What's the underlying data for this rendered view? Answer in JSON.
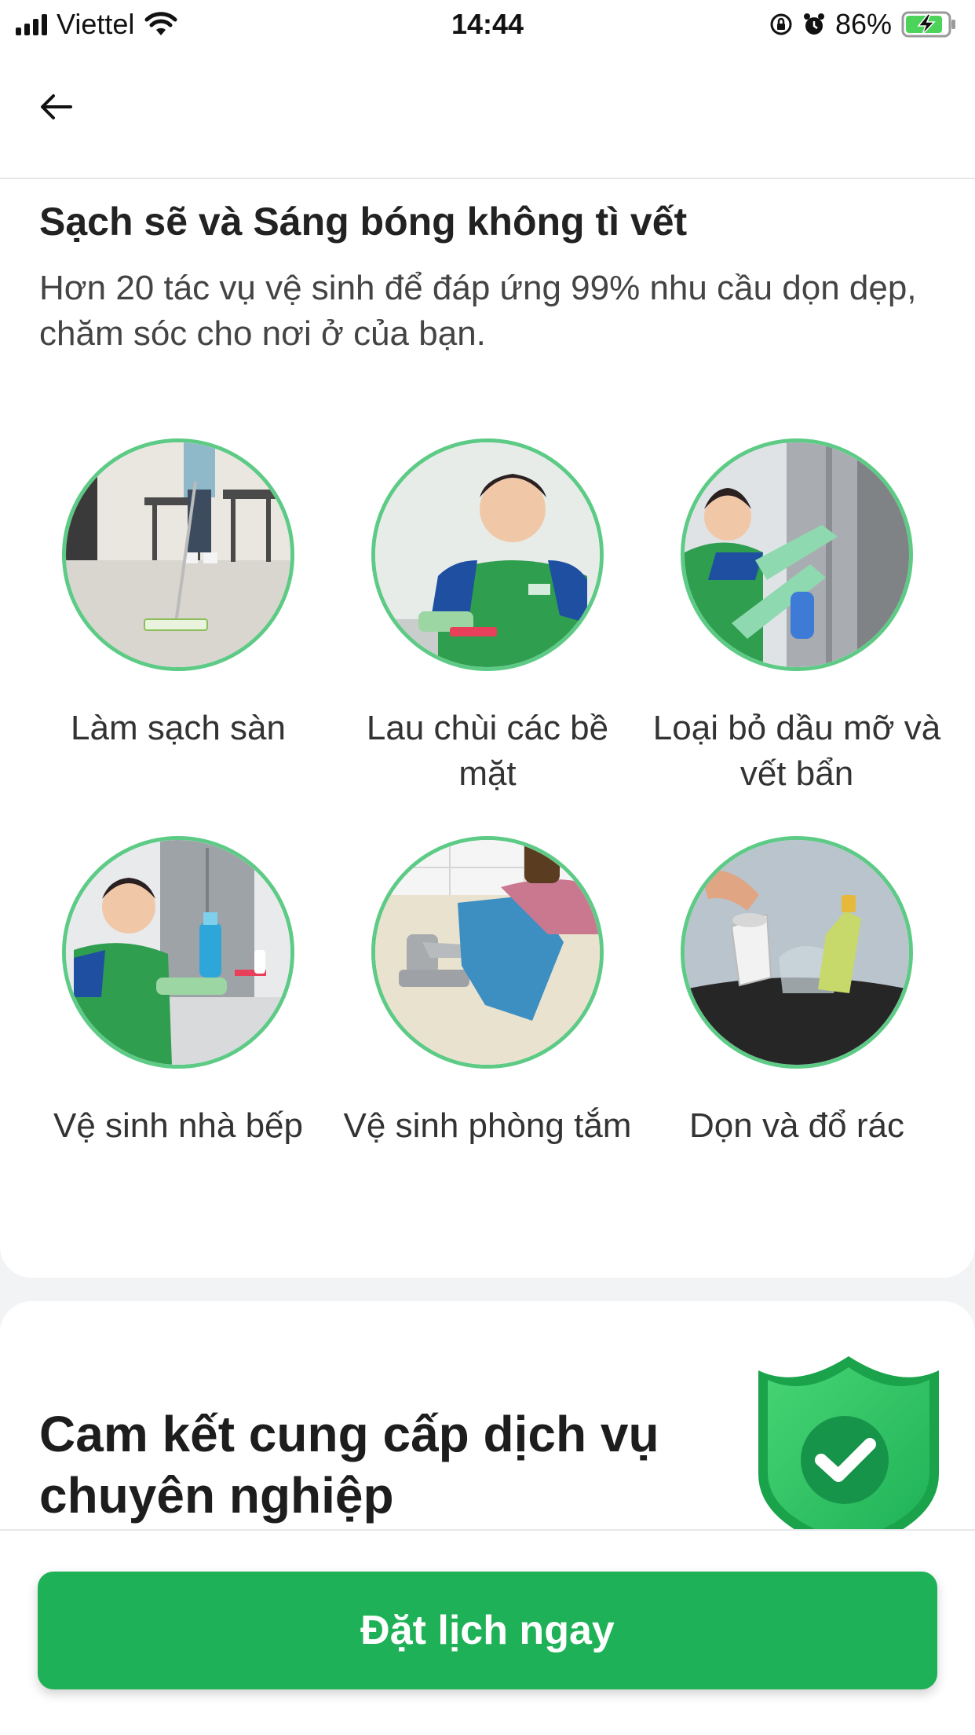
{
  "status_bar": {
    "carrier": "Viettel",
    "time": "14:44",
    "battery_percent": "86%",
    "icons": [
      "signal-icon",
      "wifi-icon",
      "orientation-lock-icon",
      "alarm-icon",
      "battery-charging-icon"
    ]
  },
  "nav": {
    "back_icon": "arrow-left-icon"
  },
  "intro": {
    "title": "Sạch sẽ và Sáng bóng không tì vết",
    "description": "Hơn 20 tác vụ vệ sinh để đáp ứng 99% nhu cầu dọn dẹp, chăm sóc cho nơi ở của bạn."
  },
  "tasks": [
    {
      "label": "Làm sạch sàn",
      "icon": "floor-mopping-photo"
    },
    {
      "label": "Lau chùi các bề mặt",
      "icon": "surface-wiping-photo"
    },
    {
      "label": "Loại bỏ dầu mỡ và vết bẩn",
      "icon": "grease-removal-photo"
    },
    {
      "label": "Vệ sinh nhà bếp",
      "icon": "kitchen-cleaning-photo"
    },
    {
      "label": "Vệ sinh phòng tắm",
      "icon": "bathroom-cleaning-photo"
    },
    {
      "label": "Dọn và đổ rác",
      "icon": "trash-disposal-photo"
    }
  ],
  "commitment": {
    "title": "Cam kết cung cấp dịch vụ chuyên nghiệp",
    "icon": "shield-check-icon"
  },
  "cta": {
    "label": "Đặt lịch ngay"
  },
  "colors": {
    "brand_green": "#1fb157",
    "circle_border": "#5dcb86",
    "uniform_green": "#2f9e4f",
    "uniform_blue": "#1f4fa0"
  }
}
